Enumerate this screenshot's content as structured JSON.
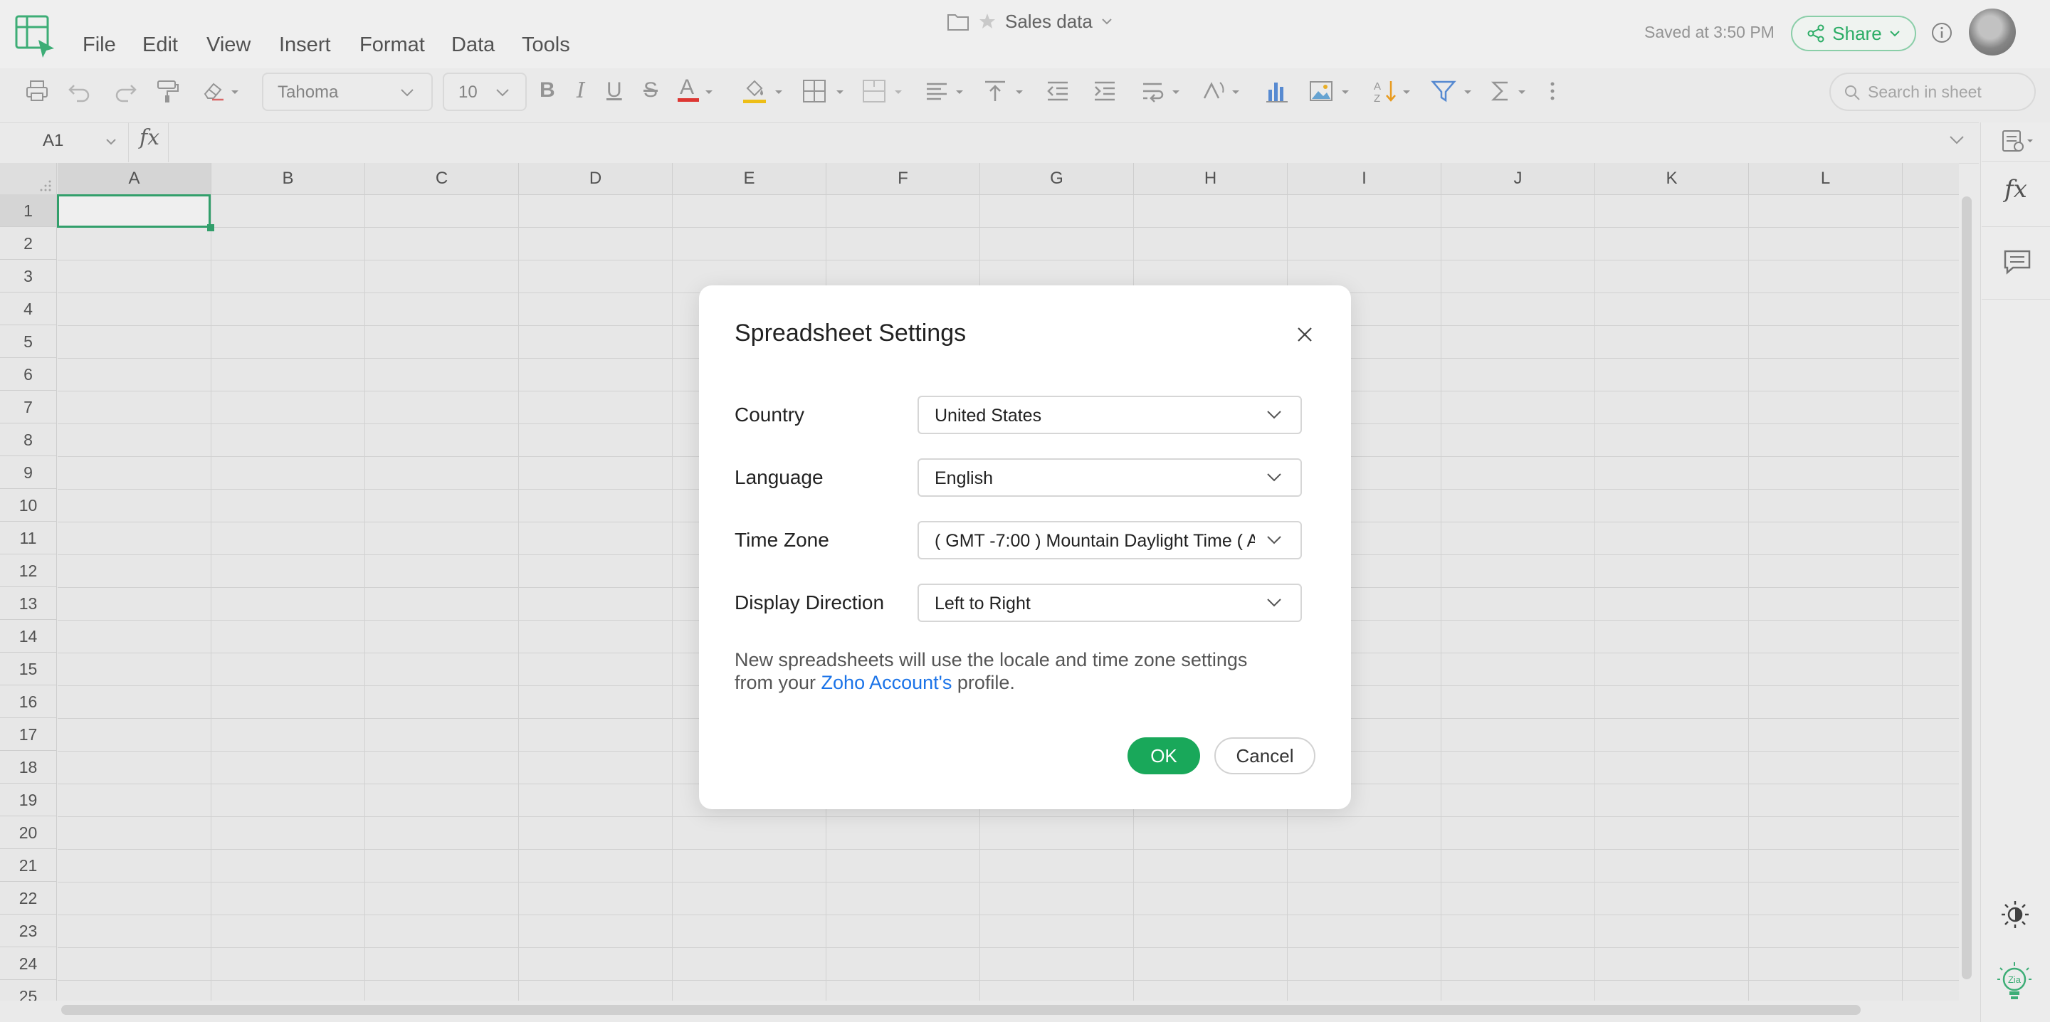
{
  "menu": {
    "items": [
      "File",
      "Edit",
      "View",
      "Insert",
      "Format",
      "Data",
      "Tools"
    ]
  },
  "document": {
    "title": "Sales data",
    "saved_status": "Saved at 3:50 PM"
  },
  "header": {
    "share_label": "Share"
  },
  "toolbar": {
    "font_name": "Tahoma",
    "font_size": "10",
    "search_placeholder": "Search in sheet",
    "font_color": "#e53935",
    "fill_color": "#f5c518"
  },
  "formula_bar": {
    "cell_ref": "A1",
    "fx_label": "fx"
  },
  "grid": {
    "columns": [
      "A",
      "B",
      "C",
      "D",
      "E",
      "F",
      "G",
      "H",
      "I",
      "J",
      "K",
      "L"
    ],
    "rows": [
      "1",
      "2",
      "3",
      "4",
      "5",
      "6",
      "7",
      "8",
      "9",
      "10",
      "11",
      "12",
      "13",
      "14",
      "15",
      "16",
      "17",
      "18",
      "19",
      "20",
      "21",
      "22",
      "23",
      "24",
      "25"
    ],
    "selected_cell": "A1",
    "accent": "#34a56f"
  },
  "dialog": {
    "title": "Spreadsheet Settings",
    "fields": [
      {
        "label": "Country",
        "value": "United States"
      },
      {
        "label": "Language",
        "value": "English"
      },
      {
        "label": "Time Zone",
        "value": "( GMT -7:00 ) Mountain Daylight Time ( A..."
      },
      {
        "label": "Display Direction",
        "value": "Left to Right"
      }
    ],
    "note_prefix": "New spreadsheets will use the locale and time zone settings from your",
    "note_link": "Zoho Account's",
    "note_suffix": "profile.",
    "ok_label": "OK",
    "cancel_label": "Cancel",
    "ok_color": "#19a85a",
    "link_color": "#1a73e8"
  },
  "side_panel": {
    "fx_label": "fx"
  }
}
